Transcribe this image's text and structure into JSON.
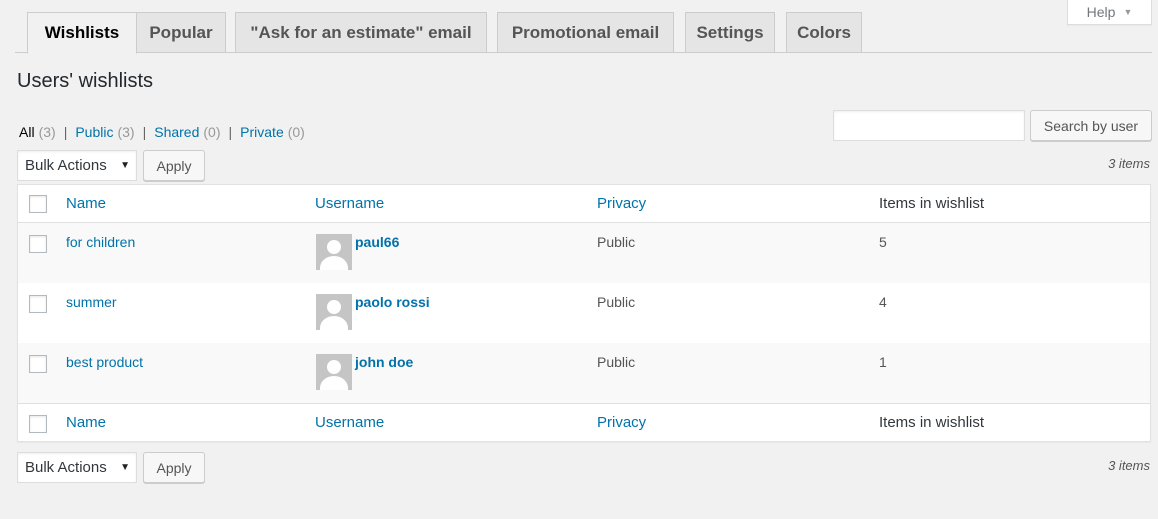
{
  "help": {
    "label": "Help"
  },
  "tabs": [
    {
      "label": "Wishlists",
      "active": true
    },
    {
      "label": "Popular",
      "active": false
    },
    {
      "label": "\"Ask for an estimate\" email",
      "active": false
    },
    {
      "label": "Promotional email",
      "active": false
    },
    {
      "label": "Settings",
      "active": false
    },
    {
      "label": "Colors",
      "active": false
    }
  ],
  "page_title": "Users' wishlists",
  "filters": [
    {
      "label": "All",
      "count": "(3)",
      "current": true
    },
    {
      "label": "Public",
      "count": "(3)",
      "current": false
    },
    {
      "label": "Shared",
      "count": "(0)",
      "current": false
    },
    {
      "label": "Private",
      "count": "(0)",
      "current": false
    }
  ],
  "search": {
    "value": "",
    "button_label": "Search by user"
  },
  "bulk": {
    "selected": "Bulk Actions",
    "apply_label": "Apply"
  },
  "items_count": "3 items",
  "table": {
    "columns": [
      "Name",
      "Username",
      "Privacy",
      "Items in wishlist"
    ],
    "rows": [
      {
        "name": "for children",
        "username": "paul66",
        "privacy": "Public",
        "items": "5"
      },
      {
        "name": "summer",
        "username": "paolo rossi",
        "privacy": "Public",
        "items": "4"
      },
      {
        "name": "best product",
        "username": "john doe",
        "privacy": "Public",
        "items": "1"
      }
    ]
  },
  "colors": {
    "link": "#0073aa",
    "background": "#f1f1f1"
  }
}
